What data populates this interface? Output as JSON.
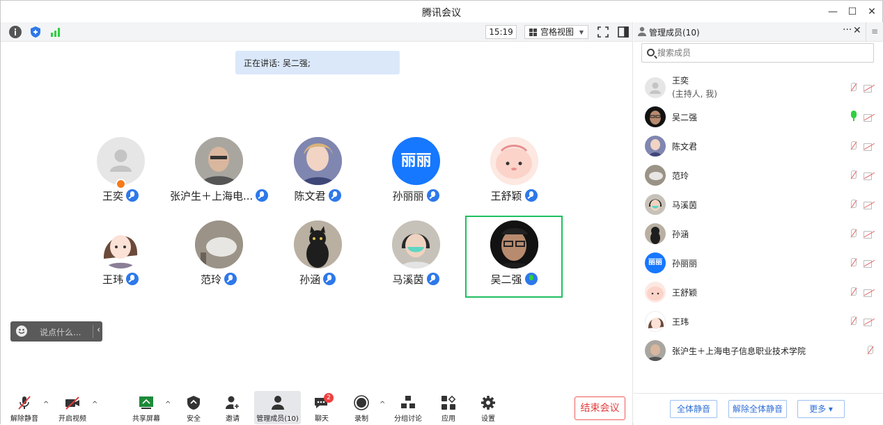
{
  "window": {
    "title": "腾讯会议"
  },
  "topbar": {
    "time": "15:19",
    "view_mode": "宫格视图"
  },
  "speaking": {
    "text": "正在讲话: 吴二强;"
  },
  "tiles": [
    {
      "name": "王奕"
    },
    {
      "name": "张沪生＋上海电..."
    },
    {
      "name": "陈文君"
    },
    {
      "name": "孙丽丽",
      "avatar_text": "丽丽"
    },
    {
      "name": "王舒颖"
    },
    {
      "name": "王玮"
    },
    {
      "name": "范玲"
    },
    {
      "name": "孙涵"
    },
    {
      "name": "马溪茵"
    },
    {
      "name": "吴二强"
    }
  ],
  "chat": {
    "placeholder": "说点什么..."
  },
  "toolbar": {
    "unmute": "解除静音",
    "start_video": "开启视频",
    "share_screen": "共享屏幕",
    "security": "安全",
    "invite": "邀请",
    "manage_members": "管理成员(10)",
    "chat": "聊天",
    "chat_badge": "2",
    "record": "录制",
    "breakout": "分组讨论",
    "apps": "应用",
    "settings": "设置",
    "end_meeting": "结束会议"
  },
  "panel": {
    "title": "管理成员(10)",
    "search_placeholder": "搜索成员",
    "members": [
      {
        "name": "王奕",
        "sub": "(主持人, 我)",
        "mic": "off"
      },
      {
        "name": "吴二强",
        "mic": "on"
      },
      {
        "name": "陈文君",
        "mic": "off"
      },
      {
        "name": "范玲",
        "mic": "off"
      },
      {
        "name": "马溪茵",
        "mic": "off"
      },
      {
        "name": "孙涵",
        "mic": "off"
      },
      {
        "name": "孙丽丽",
        "avatar_text": "丽丽",
        "mic": "off"
      },
      {
        "name": "王舒颖",
        "mic": "off"
      },
      {
        "name": "王玮",
        "mic": "off"
      },
      {
        "name": "张沪生＋上海电子信息职业技术学院",
        "mic": "off"
      }
    ],
    "mute_all": "全体静音",
    "unmute_all": "解除全体静音",
    "more": "更多 ▾"
  },
  "colors": {
    "accent": "#2e78ea",
    "active_speaker": "#1fbf5f",
    "end": "#e23d3d"
  }
}
